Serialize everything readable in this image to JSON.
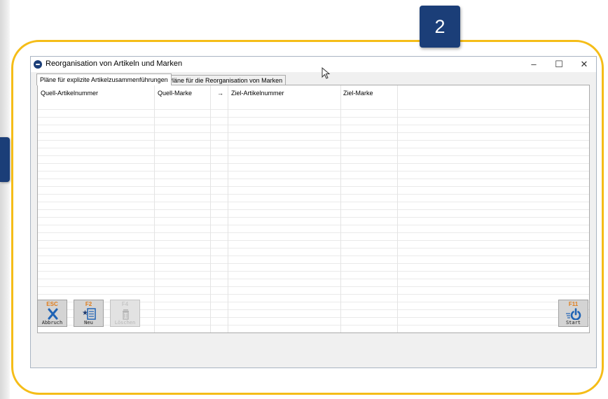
{
  "step_badge": "2",
  "window": {
    "title": "Reorganisation von Artikeln und Marken",
    "minimize": "–",
    "maximize": "☐",
    "close": "✕"
  },
  "tabs": [
    {
      "label": "Pläne für explizite Artikelzusammenführungen",
      "active": true
    },
    {
      "label": "Pläne für die Reorganisation von Marken",
      "active": false
    }
  ],
  "table": {
    "columns": [
      "Quell-Artikelnummer",
      "Quell-Marke",
      "→",
      "Ziel-Artikelnummer",
      "Ziel-Marke"
    ]
  },
  "toolbar": {
    "abort": {
      "key": "ESC",
      "label": "Abbruch",
      "icon": "close-icon"
    },
    "new": {
      "key": "F2",
      "label": "Neu",
      "icon": "new-list-star-icon"
    },
    "delete": {
      "key": "F4",
      "label": "Löschen",
      "icon": "trash-icon",
      "disabled": true
    },
    "start": {
      "key": "F11",
      "label": "Start",
      "icon": "power-start-icon"
    }
  },
  "colors": {
    "badge": "#1b3e78",
    "highlight": "#f5bd18",
    "function_key": "#e07c1a",
    "icon_blue": "#1f63b5"
  }
}
